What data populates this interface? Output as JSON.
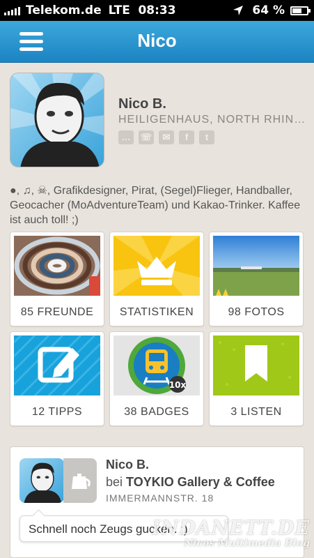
{
  "status_bar": {
    "carrier": "Telekom.de",
    "network": "LTE",
    "time": "08:33",
    "battery": "64 %",
    "battery_level": 0.64
  },
  "nav": {
    "title": "Nico",
    "menu_icon": "hamburger-menu-icon"
  },
  "profile": {
    "name": "Nico B.",
    "location": "HEILIGENHAUS, NORTH RHINE-WESTPHALIA",
    "contact_icons": [
      "chat-icon",
      "phone-icon",
      "mail-icon",
      "facebook-icon",
      "twitter-icon"
    ],
    "bio_icons": [
      "apple-icon",
      "music-note-icon",
      "skull-crossbones-icon"
    ],
    "bio": "Grafikdesigner, Pirat, (Segel)Flieger, Handballer, Geocacher (MoAdventureTeam) und Kakao-Trinker. Kaffee ist auch toll! ;)"
  },
  "tiles": [
    {
      "label": "85 FREUNDE",
      "icon": "friends-swirl-image"
    },
    {
      "label": "STATISTIKEN",
      "icon": "crown-icon"
    },
    {
      "label": "98 FOTOS",
      "icon": "field-photo-image"
    },
    {
      "label": "12 TIPPS",
      "icon": "edit-icon"
    },
    {
      "label": "38 BADGES",
      "icon": "train-badge-icon"
    },
    {
      "label": "3 LISTEN",
      "icon": "bookmark-icon"
    }
  ],
  "checkin": {
    "user": "Nico B.",
    "at": "bei",
    "venue": "TOYKIO Gallery & Coffee",
    "address": "IMMERMANNSTR. 18",
    "shout": "Schnell noch Zeugs gucken. ;)",
    "venue_icon": "coffee-pot-icon"
  },
  "watermark": {
    "line1": "INDANETT.DE",
    "line2": "Nicos Multimedia Blog"
  },
  "colors": {
    "nav_blue": "#1b84c2",
    "background": "#e8e4dd",
    "stats_yellow": "#f8c410",
    "tips_blue": "#17a2db",
    "lists_green": "#a0c818"
  }
}
